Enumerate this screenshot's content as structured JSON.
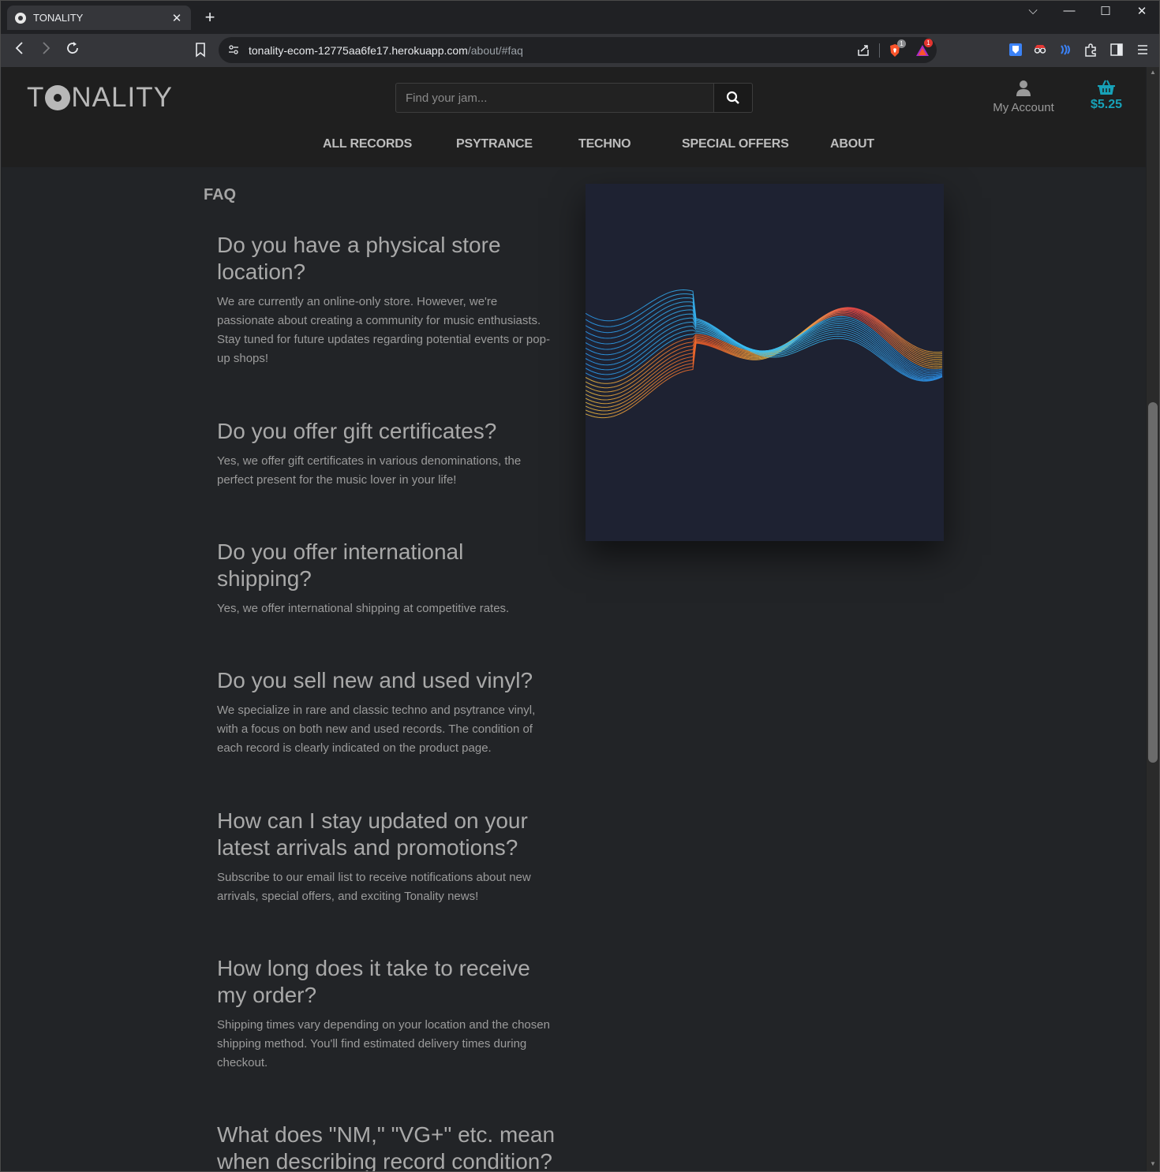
{
  "browser": {
    "tab_title": "TONALITY",
    "url_host": "tonality-ecom-12775aa6fe17.herokuapp.com",
    "url_path": "/about/#faq",
    "shields_badge": "1",
    "rewards_badge": "1"
  },
  "header": {
    "logo_text_pre": "T",
    "logo_text_post": "NALITY",
    "search_placeholder": "Find your jam...",
    "account_label": "My Account",
    "basket_total": "$5.25",
    "nav": [
      "ALL RECORDS",
      "PSYTRANCE",
      "TECHNO",
      "SPECIAL OFFERS",
      "ABOUT"
    ]
  },
  "faq": {
    "heading": "FAQ",
    "items": [
      {
        "q": "Do you have a physical store location?",
        "a": "We are currently an online-only store. However, we're passionate about creating a community for music enthusiasts. Stay tuned for future updates regarding potential events or pop-up shops!"
      },
      {
        "q": "Do you offer gift certificates?",
        "a": "Yes, we offer gift certificates in various denominations, the perfect present for the music lover in your life!"
      },
      {
        "q": "Do you offer international shipping?",
        "a": "Yes, we offer international shipping at competitive rates."
      },
      {
        "q": "Do you sell new and used vinyl?",
        "a": "We specialize in rare and classic techno and psytrance vinyl, with a focus on both new and used records. The condition of each record is clearly indicated on the product page."
      },
      {
        "q": "How can I stay updated on your latest arrivals and promotions?",
        "a": "Subscribe to our email list to receive notifications about new arrivals, special offers, and exciting Tonality news!"
      },
      {
        "q": "How long does it take to receive my order?",
        "a": "Shipping times vary depending on your location and the chosen shipping method. You'll find estimated delivery times during checkout."
      },
      {
        "q": "What does \"NM,\" \"VG+\" etc. mean when describing record condition?",
        "a": ""
      }
    ]
  },
  "colors": {
    "accent": "#17a2b8",
    "page_bg": "#222427",
    "header_bg": "#1f1f1f",
    "art_bg": "#1e2232"
  },
  "icons": {
    "search": "magnifier-icon",
    "account": "user-icon",
    "basket": "basket-icon"
  }
}
